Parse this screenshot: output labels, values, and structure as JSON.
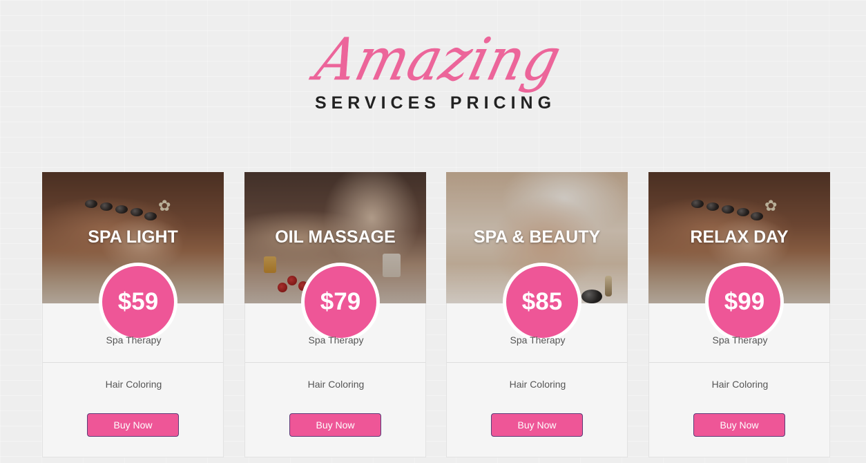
{
  "header": {
    "script_title": "Amazing",
    "title": "SERVICES PRICING"
  },
  "colors": {
    "accent": "#ee5697",
    "button_border": "#5a3c78",
    "title_text": "#222222",
    "body_text": "#555555"
  },
  "cards": [
    {
      "name": "SPA LIGHT",
      "price": "$59",
      "feature_1": "Spa Therapy",
      "feature_2": "Hair Coloring",
      "button_label": "Buy Now",
      "image": "hot-stone-massage-photo"
    },
    {
      "name": "OIL MASSAGE",
      "price": "$79",
      "feature_1": "Spa Therapy",
      "feature_2": "Hair Coloring",
      "button_label": "Buy Now",
      "image": "back-massage-photo"
    },
    {
      "name": "SPA & BEAUTY",
      "price": "$85",
      "feature_1": "Spa Therapy",
      "feature_2": "Hair Coloring",
      "button_label": "Buy Now",
      "image": "facial-massage-photo"
    },
    {
      "name": "RELAX DAY",
      "price": "$99",
      "feature_1": "Spa Therapy",
      "feature_2": "Hair Coloring",
      "button_label": "Buy Now",
      "image": "hot-stone-massage-photo"
    }
  ]
}
